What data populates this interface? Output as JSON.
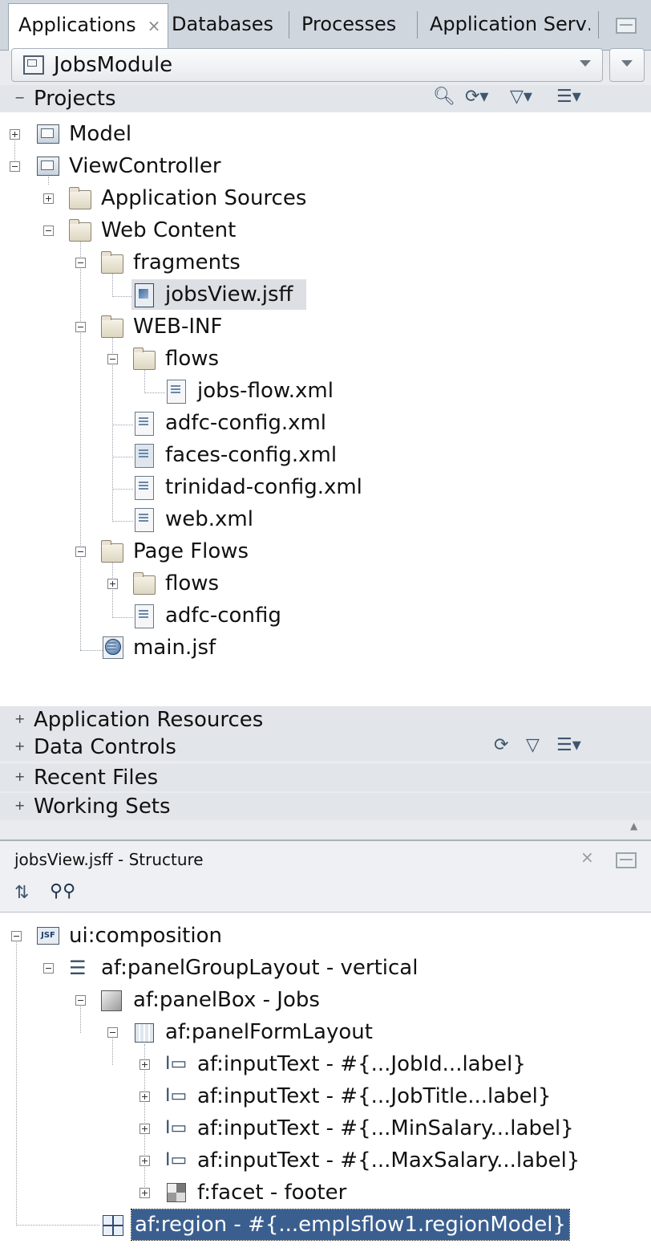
{
  "tabs": [
    {
      "label": "Applications",
      "active": true
    },
    {
      "label": "Databases"
    },
    {
      "label": "Processes"
    },
    {
      "label": "Application Serv…"
    }
  ],
  "app_selector": {
    "value": "JobsModule"
  },
  "projects": {
    "header": "Projects",
    "tree": {
      "model": "Model",
      "viewcontroller": "ViewController",
      "application_sources": "Application Sources",
      "web_content": "Web Content",
      "fragments": "fragments",
      "jobsview": "jobsView.jsff",
      "web_inf": "WEB-INF",
      "flows": "flows",
      "jobs_flow": "jobs-flow.xml",
      "adfc_config_xml": "adfc-config.xml",
      "faces_config": "faces-config.xml",
      "trinidad_config": "trinidad-config.xml",
      "web_xml": "web.xml",
      "page_flows": "Page Flows",
      "pf_flows": "flows",
      "pf_adfc_config": "adfc-config",
      "main_jsf": "main.jsf"
    }
  },
  "accordion": {
    "application_resources": "Application Resources",
    "data_controls": "Data Controls",
    "recent_files": "Recent Files",
    "working_sets": "Working Sets"
  },
  "structure": {
    "title": "jobsView.jsff - Structure",
    "nodes": {
      "composition": "ui:composition",
      "panel_group": "af:panelGroupLayout - vertical",
      "panel_box": "af:panelBox - Jobs",
      "panel_form": "af:panelFormLayout",
      "input_jobid": "af:inputText - #{...JobId...label}",
      "input_jobtitle": "af:inputText - #{...JobTitle...label}",
      "input_minsalary": "af:inputText - #{...MinSalary...label}",
      "input_maxsalary": "af:inputText - #{...MaxSalary...label}",
      "facet_footer": "f:facet - footer",
      "region": "af:region - #{...emplsflow1.regionModel}"
    },
    "tag_icon": "JSF"
  },
  "icons": {
    "close": "close-icon",
    "search": "search-icon",
    "sync": "sync-icon",
    "filter": "filter-icon",
    "options": "options-icon",
    "binoculars": "binoculars-icon",
    "freeze": "freeze-icon"
  }
}
